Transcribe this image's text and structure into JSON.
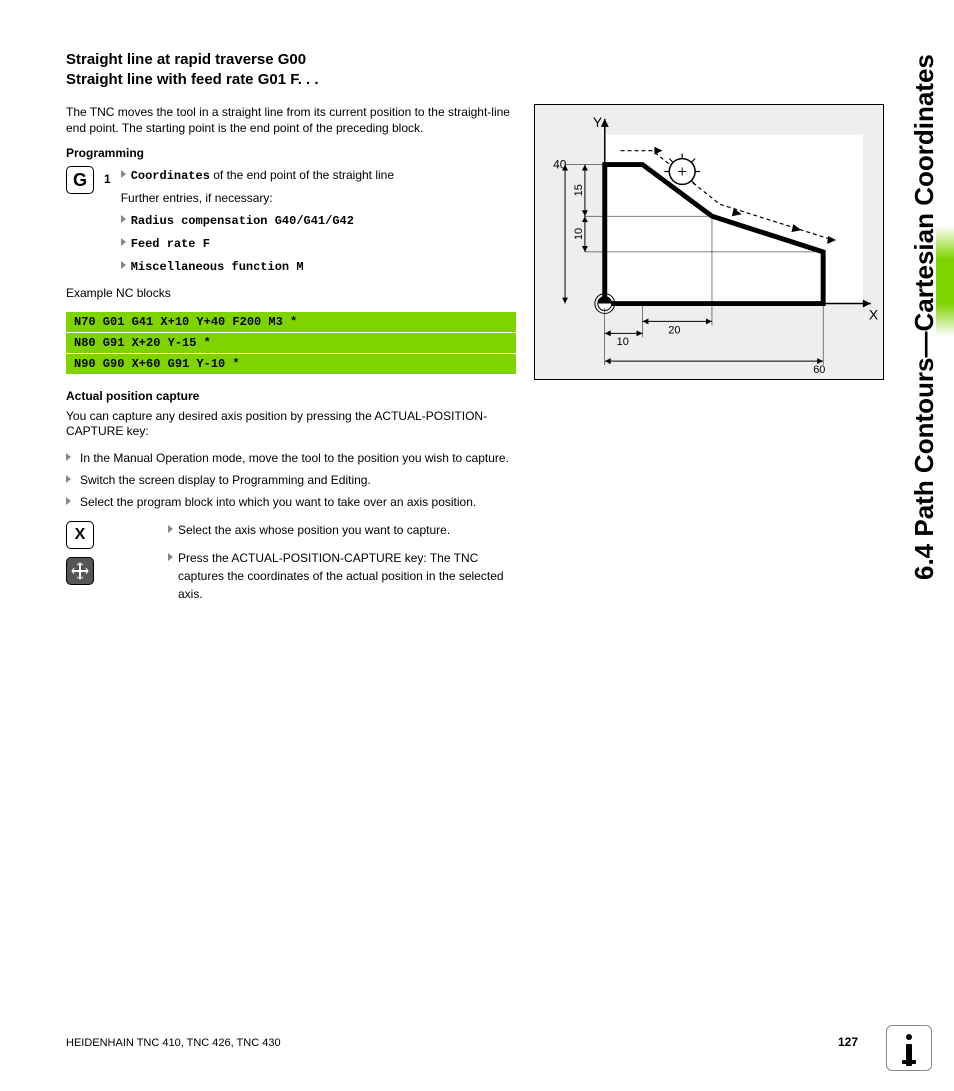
{
  "title": "Straight line at rapid traverse G00\nStraight line with feed rate G01 F. . .",
  "intro": "The TNC moves the tool in a straight line from its current position to the straight-line end point. The starting point is the end point of the preceding block.",
  "subhead_prog": "Programming",
  "key_G": "G",
  "key_G_num": "1",
  "prog": {
    "coord_label": "Coordinates",
    "coord_rest": " of the end point of the straight line",
    "further": "Further entries, if necessary:",
    "radius": "Radius compensation G40/G41/G42",
    "feed": "Feed rate F",
    "misc": "Miscellaneous function M"
  },
  "example_label": "Example NC blocks",
  "nc": [
    "N70 G01 G41 X+10 Y+40 F200 M3 *",
    "N80 G91 X+20 Y-15  *",
    "N90 G90 X+60 G91 Y-10 *"
  ],
  "actual_head": "Actual position capture",
  "actual_intro": "You can capture any desired axis position by pressing the ACTUAL-POSITION-CAPTURE key:",
  "steps": [
    "In the Manual Operation mode, move the tool to the position you wish to capture.",
    "Switch the screen display to Programming and Editing.",
    "Select the program block into which you want to take over an axis position."
  ],
  "key_X": "X",
  "select_axis": "Select the axis whose position you want to capture.",
  "press_capture": "Press the ACTUAL-POSITION-CAPTURE key: The TNC captures the coordinates of the actual position in the selected axis.",
  "side_label": "6.4 Path Contours—Cartesian Coordinates",
  "footer": "HEIDENHAIN TNC 410, TNC 426, TNC 430",
  "page": "127",
  "fig": {
    "y": "Y",
    "x": "X",
    "v40": "40",
    "v15": "15",
    "v10": "10",
    "h10": "10",
    "h20": "20",
    "h60": "60"
  }
}
